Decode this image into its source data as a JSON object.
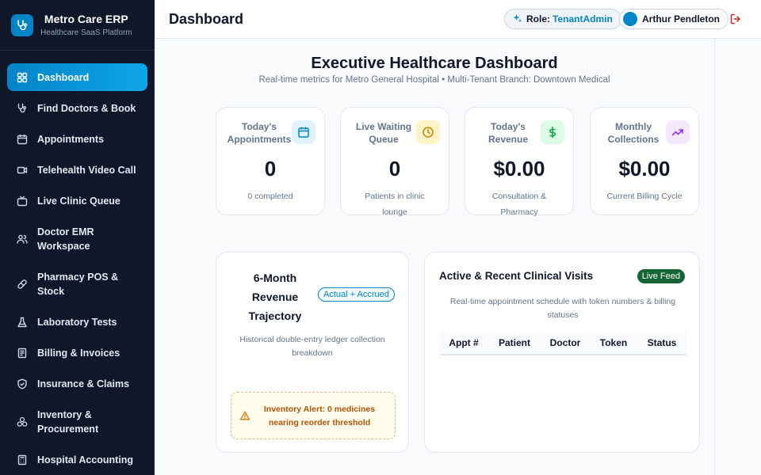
{
  "app": {
    "title": "Metro Care ERP",
    "subtitle": "Healthcare SaaS Platform"
  },
  "sidebar": {
    "items": [
      {
        "label": "Dashboard",
        "icon": "grid-icon",
        "active": true
      },
      {
        "label": "Find Doctors & Book",
        "icon": "stethoscope-icon"
      },
      {
        "label": "Appointments",
        "icon": "calendar-icon"
      },
      {
        "label": "Telehealth Video Call",
        "icon": "video-icon"
      },
      {
        "label": "Live Clinic Queue",
        "icon": "tv-icon"
      },
      {
        "label": "Doctor EMR Workspace",
        "icon": "users-icon"
      },
      {
        "label": "Pharmacy POS & Stock",
        "icon": "pill-icon"
      },
      {
        "label": "Laboratory Tests",
        "icon": "flask-icon"
      },
      {
        "label": "Billing & Invoices",
        "icon": "receipt-icon"
      },
      {
        "label": "Insurance & Claims",
        "icon": "shield-icon"
      },
      {
        "label": "Inventory & Procurement",
        "icon": "boxes-icon"
      },
      {
        "label": "Hospital Accounting",
        "icon": "calculator-icon"
      }
    ]
  },
  "header": {
    "title": "Dashboard",
    "role_label": "Role:",
    "role_value": "TenantAdmin",
    "user_name": "Arthur Pendleton"
  },
  "hero": {
    "title": "Executive Healthcare Dashboard",
    "subtitle": "Real-time metrics for Metro General Hospital • Multi-Tenant Branch: Downtown Medical"
  },
  "kpis": [
    {
      "title": "Today's Appointments",
      "value": "0",
      "sub": "0 completed",
      "icon": "calendar-icon",
      "color": "#0284c7",
      "bg": "#e0f2fe"
    },
    {
      "title": "Live Waiting Queue",
      "value": "0",
      "sub": "Patients in clinic lounge",
      "icon": "clock-icon",
      "color": "#ca8a04",
      "bg": "#fef3c7"
    },
    {
      "title": "Today's Revenue",
      "value": "$0.00",
      "sub": "Consultation & Pharmacy",
      "icon": "dollar-icon",
      "color": "#16a34a",
      "bg": "#dcfce7"
    },
    {
      "title": "Monthly Collections",
      "value": "$0.00",
      "sub": "Current Billing Cycle",
      "icon": "trend-up-icon",
      "color": "#9333ea",
      "bg": "#f3e8ff"
    }
  ],
  "revenue": {
    "title": "6-Month Revenue Trajectory",
    "badge": "Actual + Accrued",
    "subtitle": "Historical double-entry ledger collection breakdown",
    "alert": "Inventory Alert: 0 medicines nearing reorder threshold"
  },
  "visits": {
    "title": "Active & Recent Clinical Visits",
    "badge": "Live Feed",
    "subtitle": "Real-time appointment schedule with token numbers & billing statuses",
    "columns": [
      "Appt #",
      "Patient",
      "Doctor",
      "Token",
      "Status"
    ]
  },
  "colors": {
    "sidebar_bg": "#0f172a",
    "accent": "#0ea5e9",
    "danger": "#dc2626"
  }
}
